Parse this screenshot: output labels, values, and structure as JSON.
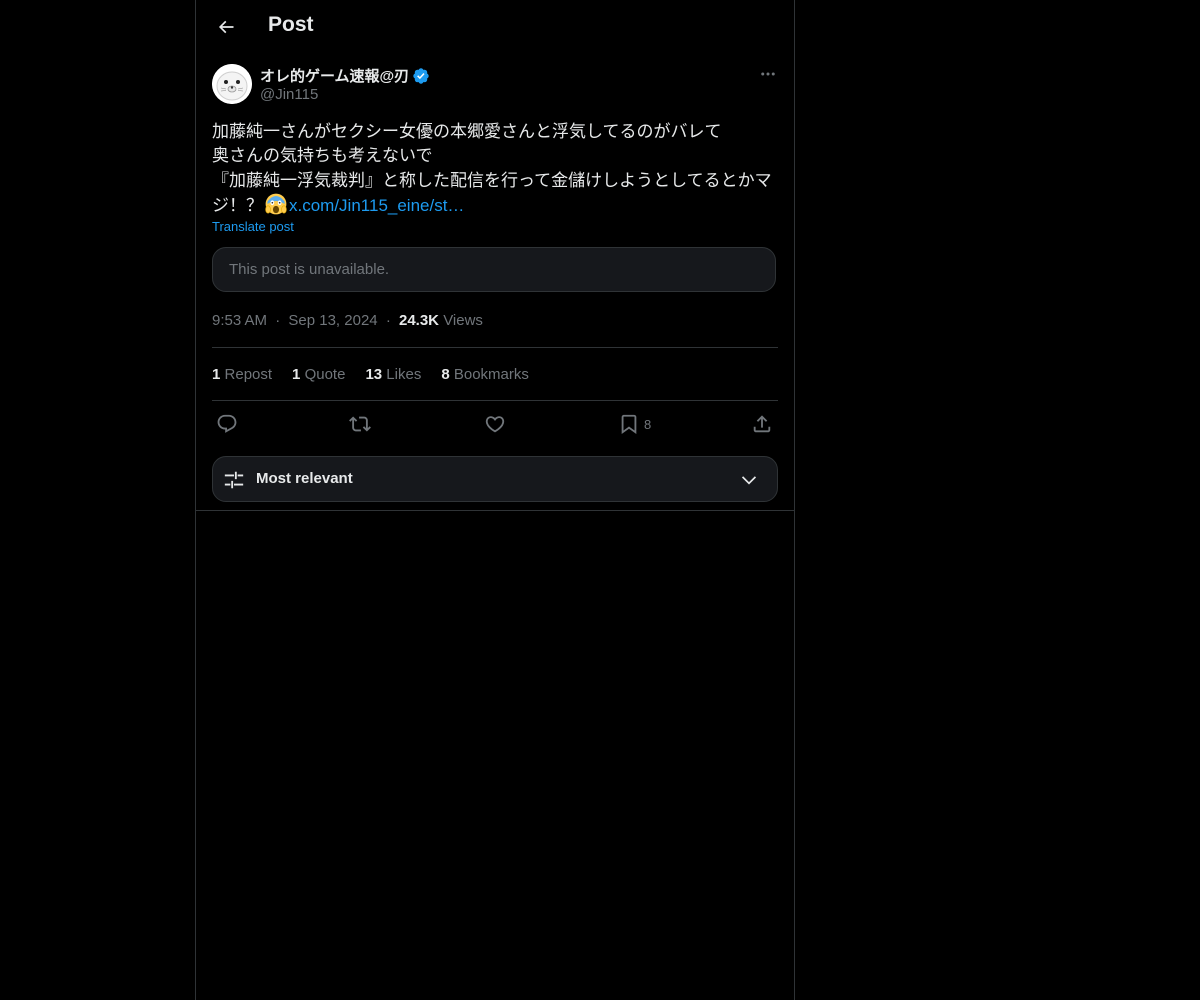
{
  "header": {
    "title": "Post",
    "back_icon": "arrow-left-icon"
  },
  "tweet": {
    "author_name": "オレ的ゲーム速報@刃",
    "handle": "@Jin115",
    "verified": true,
    "text_lines": [
      "加藤純一さんがセクシー女優の本郷愛さんと浮気してるのがバレて",
      "奥さんの気持ちも考えないで",
      "『加藤純一浮気裁判』と称した配信を行って金儲けしようとしてるとかマ",
      "ジ！？"
    ],
    "emoji": "face-screaming-in-fear",
    "link_text": "x.com/Jin115_eine/st…",
    "translate_label": "Translate post",
    "unavailable_text": "This post is unavailable.",
    "time": "9:53 AM",
    "date": "Sep 13, 2024",
    "views_count": "24.3K",
    "views_label": "Views",
    "sep": "·"
  },
  "stats": {
    "repost_count": "1",
    "repost_label": "Repost",
    "quote_count": "1",
    "quote_label": "Quote",
    "likes_count": "13",
    "likes_label": "Likes",
    "bookmarks_count": "8",
    "bookmarks_label": "Bookmarks"
  },
  "actions": {
    "bookmark_count": "8"
  },
  "sort": {
    "label": "Most relevant"
  },
  "colors": {
    "background": "#000000",
    "text": "#e7e9ea",
    "muted": "#71767b",
    "accent": "#1d9bf0",
    "border": "#2f3336"
  }
}
